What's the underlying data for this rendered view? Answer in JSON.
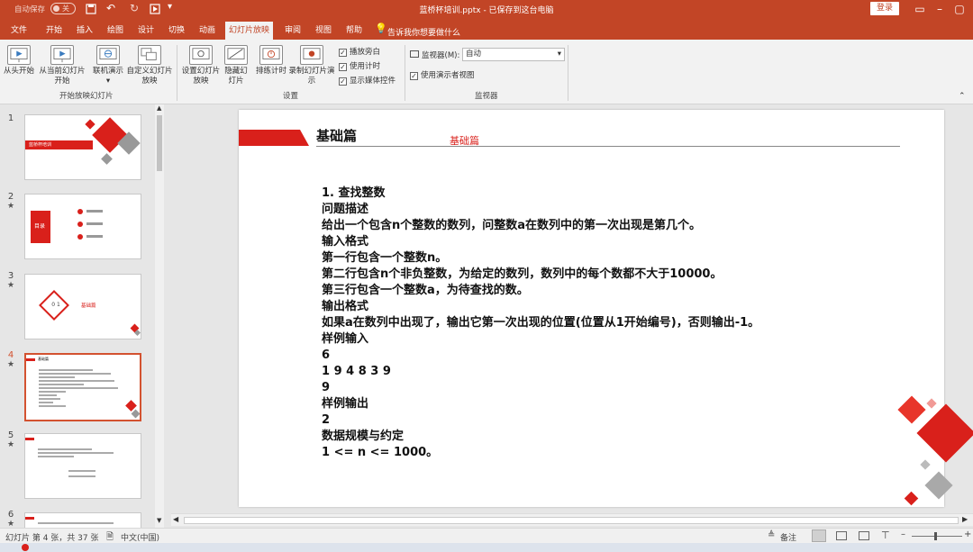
{
  "titlebar": {
    "autosave_label": "自动保存",
    "autosave_state": "关",
    "title": "蓝桥杯培训.pptx - 已保存到这台电脑",
    "login_label": "登录"
  },
  "tabs": [
    "文件",
    "开始",
    "插入",
    "绘图",
    "设计",
    "切换",
    "动画",
    "幻灯片放映",
    "审阅",
    "视图",
    "帮助"
  ],
  "active_tab": "幻灯片放映",
  "tell_me": "告诉我你想要做什么",
  "ribbon": {
    "group1": {
      "label": "开始放映幻灯片",
      "from_start": "从头开始",
      "from_current": "从当前幻灯片开始",
      "online": "联机演示",
      "custom": "自定义幻灯片放映"
    },
    "group2": {
      "label": "设置",
      "setup": "设置幻灯片放映",
      "hide": "隐藏幻灯片",
      "rehearse": "排练计时",
      "record": "录制幻灯片演示",
      "cb_narration": "播放旁白",
      "cb_timing": "使用计时",
      "cb_media": "显示媒体控件"
    },
    "group3": {
      "label": "监视器",
      "monitor_label": "监视器(M):",
      "monitor_value": "自动",
      "presenter_view": "使用演示者视图"
    }
  },
  "thumbnails": [
    {
      "num": "1",
      "star": "",
      "title": "蓝桥杯培训"
    },
    {
      "num": "2",
      "star": "★",
      "title": "目录"
    },
    {
      "num": "3",
      "star": "★",
      "title": "基础篇",
      "badge": "0 1"
    },
    {
      "num": "4",
      "star": "★",
      "title": "基础篇"
    },
    {
      "num": "5",
      "star": "★",
      "title": ""
    },
    {
      "num": "6",
      "star": "★",
      "title": ""
    }
  ],
  "slide": {
    "title": "基础篇",
    "subtitle": "基础篇",
    "lines": [
      "1. 查找整数",
      "问题描述",
      "给出一个包含n个整数的数列，问整数a在数列中的第一次出现是第几个。",
      "输入格式",
      "第一行包含一个整数n。",
      "第二行包含n个非负整数，为给定的数列，数列中的每个数都不大于10000。",
      "第三行包含一个整数a，为待查找的数。",
      "输出格式",
      "如果a在数列中出现了，输出它第一次出现的位置(位置从1开始编号)，否则输出-1。",
      "样例输入",
      "6",
      "1 9 4 8 3 9",
      "9",
      "样例输出",
      "2",
      "数据规模与约定",
      "1 <= n <= 1000。"
    ]
  },
  "statusbar": {
    "slide_info": "幻灯片 第 4 张，共 37 张",
    "language": "中文(中国)",
    "notes": "备注"
  },
  "colors": {
    "brand": "#c24526",
    "accent": "#d9201b",
    "selected": "#d35230"
  }
}
